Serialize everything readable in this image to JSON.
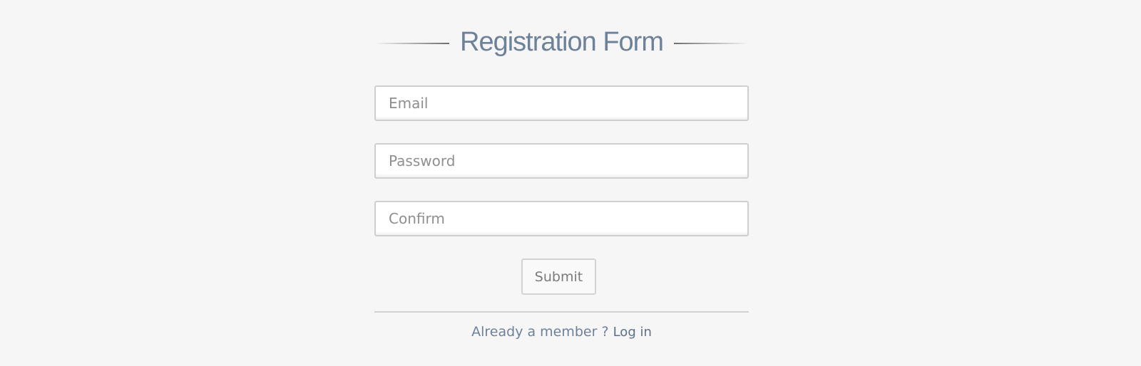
{
  "form": {
    "title": "Registration Form",
    "email_placeholder": "Email",
    "password_placeholder": "Password",
    "confirm_placeholder": "Confirm",
    "submit_label": "Submit",
    "footer_text": "Already a member ? ",
    "login_label": "Log in"
  },
  "colors": {
    "background": "#f6f6f6",
    "title": "#6d829a",
    "field_border": "#cfcfcf"
  }
}
